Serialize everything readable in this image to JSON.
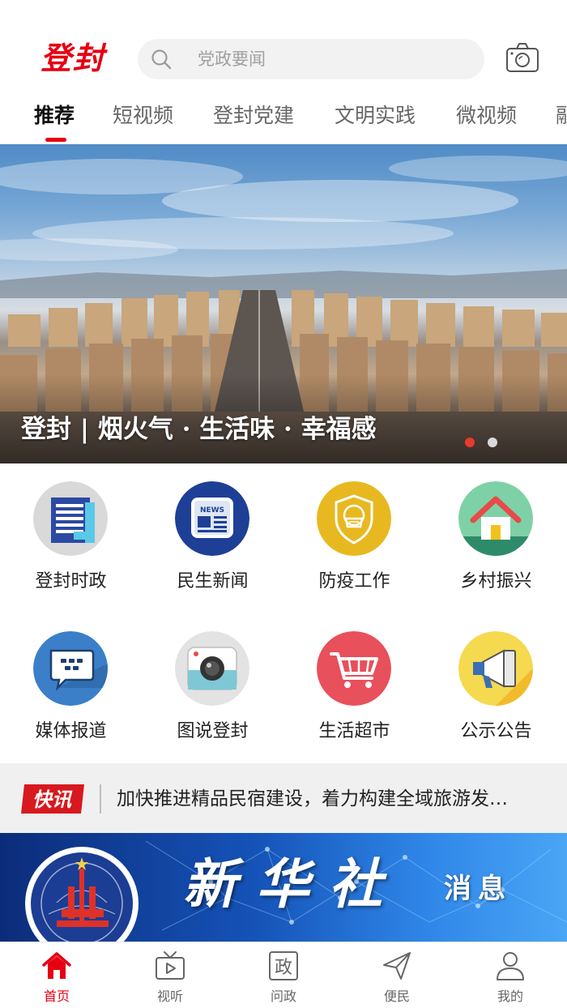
{
  "header": {
    "logo": "登封",
    "search_placeholder": "党政要闻",
    "search_icon": "search-icon",
    "camera_icon": "camera-icon"
  },
  "tabs": [
    {
      "label": "推荐",
      "active": true
    },
    {
      "label": "短视频",
      "active": false
    },
    {
      "label": "登封党建",
      "active": false
    },
    {
      "label": "文明实践",
      "active": false
    },
    {
      "label": "微视频",
      "active": false
    },
    {
      "label": "融",
      "active": false
    }
  ],
  "banner": {
    "caption": "登封 | 烟火气 · 生活味 · 幸福感",
    "slide_index": 1,
    "slide_count": 2
  },
  "grid": [
    {
      "label": "登封时政",
      "icon": "document-icon",
      "color": "#d9d9d9"
    },
    {
      "label": "民生新闻",
      "icon": "newspaper-icon",
      "color": "#1e3f96"
    },
    {
      "label": "防疫工作",
      "icon": "mask-shield-icon",
      "color": "#e8b820"
    },
    {
      "label": "乡村振兴",
      "icon": "house-icon",
      "color": "#7ed1a6"
    },
    {
      "label": "媒体报道",
      "icon": "chat-bubble-icon",
      "color": "#3a7fc8"
    },
    {
      "label": "图说登封",
      "icon": "camera-icon",
      "color": "#e3e3e3"
    },
    {
      "label": "生活超市",
      "icon": "shopping-cart-icon",
      "color": "#e8505b"
    },
    {
      "label": "公示公告",
      "icon": "megaphone-icon",
      "color": "#f5d94f"
    }
  ],
  "ticker": {
    "badge": "快讯",
    "text": "加快推进精品民宿建设，着力构建全域旅游发…"
  },
  "xinhua": {
    "brand": "新华社",
    "sub": "消息"
  },
  "nav": [
    {
      "label": "首页",
      "icon": "home-icon",
      "active": true
    },
    {
      "label": "视听",
      "icon": "tv-play-icon",
      "active": false
    },
    {
      "label": "问政",
      "icon": "zheng-icon",
      "active": false,
      "glyph": "政"
    },
    {
      "label": "便民",
      "icon": "send-icon",
      "active": false
    },
    {
      "label": "我的",
      "icon": "user-icon",
      "active": false
    }
  ],
  "colors": {
    "accent": "#e60012",
    "ticker_bg": "#f0f0f0"
  }
}
